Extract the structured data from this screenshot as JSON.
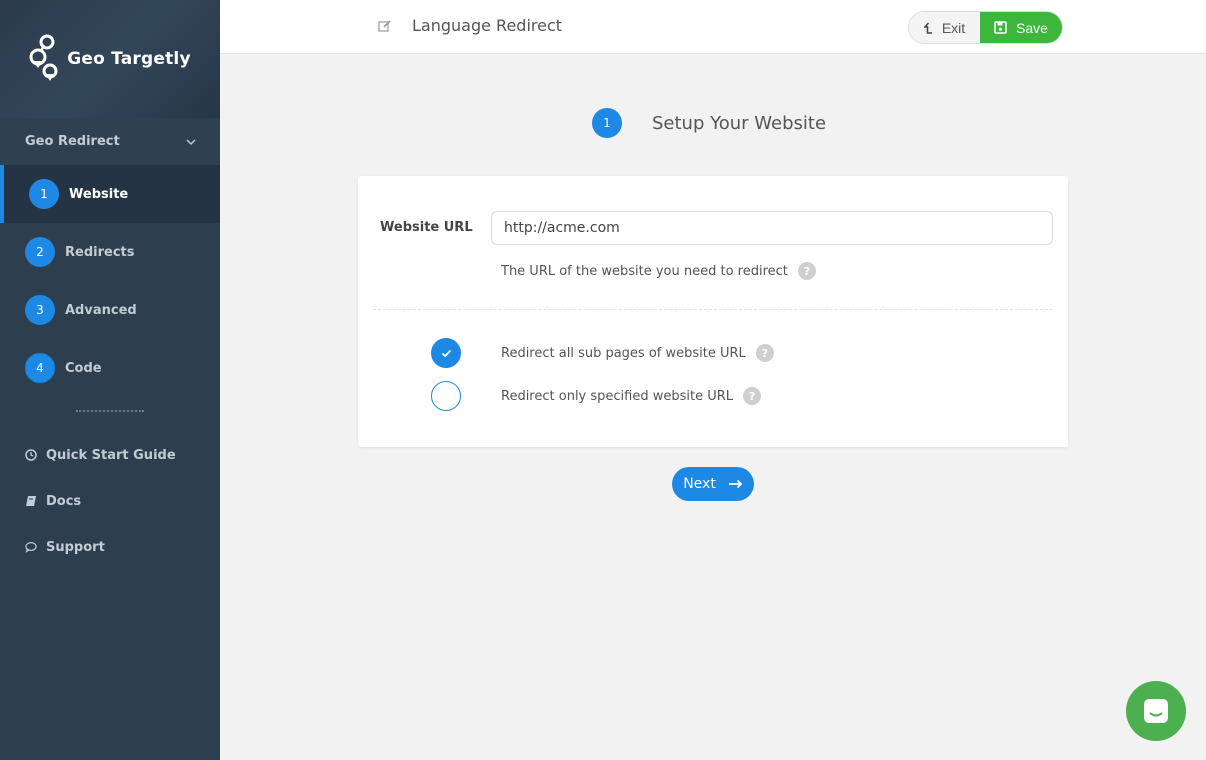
{
  "brand": {
    "name": "Geo Targetly"
  },
  "sidebar": {
    "group_label": "Geo Redirect",
    "steps": [
      {
        "num": "1",
        "label": "Website",
        "active": true
      },
      {
        "num": "2",
        "label": "Redirects"
      },
      {
        "num": "3",
        "label": "Advanced"
      },
      {
        "num": "4",
        "label": "Code"
      }
    ],
    "links": [
      {
        "label": "Quick Start Guide",
        "icon": "clock-icon"
      },
      {
        "label": "Docs",
        "icon": "book-icon"
      },
      {
        "label": "Support",
        "icon": "chat-bubble-icon"
      }
    ]
  },
  "header": {
    "title": "Language Redirect",
    "exit_label": "Exit",
    "save_label": "Save"
  },
  "stepper": {
    "num": "1",
    "label": "Setup Your Website"
  },
  "form": {
    "url_label": "Website URL",
    "url_value": "http://acme.com",
    "url_help": "The URL of the website you need to redirect",
    "help_mark": "?",
    "options": [
      {
        "label": "Redirect all sub pages of website URL",
        "checked": true
      },
      {
        "label": "Redirect only specified website URL",
        "checked": false
      }
    ]
  },
  "next_label": "Next",
  "colors": {
    "accent": "#1e88e5",
    "sidebar_bg": "#2d3e4f",
    "save": "#3cb73c",
    "chat": "#4caf50"
  }
}
